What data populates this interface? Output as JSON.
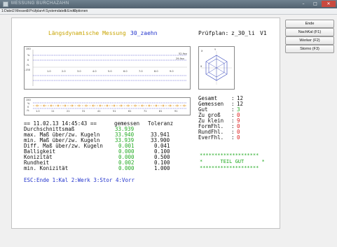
{
  "window": {
    "title": "MESSUNG BURCHAZAHN",
    "minimize": "–",
    "maximize": "□",
    "close": "✕"
  },
  "menu": [
    "1:Datei",
    "2:Messen",
    "3:Prüfplan",
    "4:Systemdaten",
    "5:Ende",
    "Optionen"
  ],
  "side_buttons": [
    "Ende",
    "NachKal (F1)",
    "Werker (F2)",
    "Storno (F3)"
  ],
  "header": {
    "title": "Längsdynamische Messung",
    "part": "30_zaehn",
    "plan_label": "Prüfplan:",
    "plan": "z_30_li",
    "version": "V1"
  },
  "chart_top": {
    "ylabels": [
      "150",
      "%",
      "0",
      "-%",
      "-150"
    ],
    "right_labels": [
      "52,9xx",
      "29,9xx"
    ],
    "xlabels": [
      "1.0",
      "2.0",
      "3.0",
      "4.0",
      "5.0",
      "6.0",
      "7.0",
      "8.0",
      "9.0"
    ]
  },
  "chart_bottom": {
    "ylabels": [
      "150",
      "%",
      "0",
      "-%"
    ],
    "xlabels": [
      "1.0",
      "11",
      "21",
      "31",
      "41",
      "51",
      "61",
      "71",
      "81",
      "91"
    ]
  },
  "polar_chart": {
    "labels": [
      "X",
      "Y",
      "X"
    ]
  },
  "counts": {
    "rows": [
      {
        "label": "Gesamt",
        "value": "12",
        "color": "blk"
      },
      {
        "label": "Gemessen",
        "value": "12",
        "color": "blk"
      },
      {
        "label": "Gut",
        "value": "3",
        "color": "grn"
      },
      {
        "label": "Zu groß",
        "value": "0",
        "color": "red"
      },
      {
        "label": "Zu klein",
        "value": "9",
        "color": "red"
      },
      {
        "label": "FormFhl.",
        "value": "0",
        "color": "red"
      },
      {
        "label": "RundFhl.",
        "value": "0",
        "color": "red"
      },
      {
        "label": "EverFhl.",
        "value": "0",
        "color": "red"
      }
    ]
  },
  "result": {
    "stars": "********************",
    "text": "*      TEIL GUT      *"
  },
  "measure": {
    "timestamp_line": "== 11.02.13 14:45:43 ==",
    "col_measured": "gemessen",
    "col_tolerance": "Toleranz",
    "rows": [
      {
        "label": "Durchschnittsmaß",
        "measured": "33.939",
        "tolerance": ""
      },
      {
        "label": "max. Maß über/zw. Kugeln",
        "measured": "33.940",
        "tolerance": "33.941"
      },
      {
        "label": "min. Maß über/zw. Kugeln",
        "measured": "33.939",
        "tolerance": "33.900"
      },
      {
        "label": "Diff. Maß über/zw. Kugeln",
        "measured": "0.001",
        "tolerance": "0.041"
      },
      {
        "label": "Balligkeit",
        "measured": "0.000",
        "tolerance": "0.100"
      },
      {
        "label": "Konizität",
        "measured": "0.000",
        "tolerance": "0.500"
      },
      {
        "label": "Rundheit",
        "measured": "0.002",
        "tolerance": "0.100"
      },
      {
        "label": "min. Konizität",
        "measured": "0.000",
        "tolerance": "1.000"
      }
    ]
  },
  "footer": "ESC:Ende 1:Kal 2:Werk 3:Stor 4:Vorr",
  "colors": {
    "title": "#c8a400",
    "accent": "#2233cc",
    "ok": "#22aa22",
    "bad": "#dd2222"
  }
}
